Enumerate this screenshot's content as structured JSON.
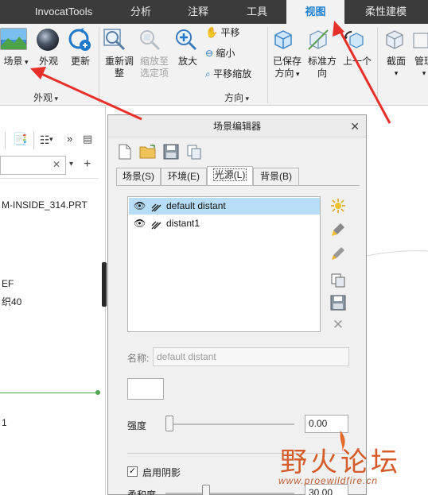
{
  "tabs": [
    {
      "label": "InvocatTools",
      "active": false
    },
    {
      "label": "分析",
      "active": false
    },
    {
      "label": "注释",
      "active": false
    },
    {
      "label": "工具",
      "active": false
    },
    {
      "label": "视图",
      "active": true
    },
    {
      "label": "柔性建模",
      "active": false
    }
  ],
  "ribbon": {
    "appearance": {
      "scene": "场景",
      "appearance": "外观",
      "update": "更新",
      "group": "外观"
    },
    "orientation": {
      "reorient_l1": "重新调",
      "reorient_l2": "整",
      "zoom_sel_l1": "缩放至",
      "zoom_sel_l2": "选定项",
      "zoom_in": "放大",
      "pan": "平移",
      "zoom_out": "缩小",
      "pan_zoom": "平移缩放",
      "saved_l1": "已保存",
      "saved_l2": "方向",
      "standard_l1": "标准方",
      "standard_l2": "向",
      "previous": "上一个",
      "group": "方向"
    },
    "model_display": {
      "section": "截面",
      "manage": "管理"
    }
  },
  "left_panel": {
    "search_placeholder": "",
    "item_part": "M-INSIDE_314.PRT",
    "item_ef": "EF",
    "item_40": "织40",
    "item_1": "1"
  },
  "dialog": {
    "title": "场景编辑器",
    "tabs": [
      {
        "label": "场景(S)",
        "active": false
      },
      {
        "label": "环境(E)",
        "active": false
      },
      {
        "label": "光源(L)",
        "active": true
      },
      {
        "label": "背景(B)",
        "active": false
      }
    ],
    "lights": [
      {
        "name": "default distant",
        "selected": true
      },
      {
        "name": "distant1",
        "selected": false
      }
    ],
    "name_label": "名称:",
    "name_value": "default distant",
    "intensity_label": "强度",
    "intensity_value": "0.00",
    "intensity_fraction": 0.0,
    "shadow_label": "启用阴影",
    "shadow_checked": "✓",
    "softness_label": "柔和度",
    "softness_value": "30.00",
    "softness_fraction": 0.3
  },
  "watermark": {
    "title": "野火论坛",
    "url": "www.proewildfire.cn"
  },
  "colors": {
    "tabbar": "#3b3b3b",
    "active_tab_text": "#1a7fd1",
    "selection": "#b8def7",
    "arrow": "#e8302a"
  }
}
